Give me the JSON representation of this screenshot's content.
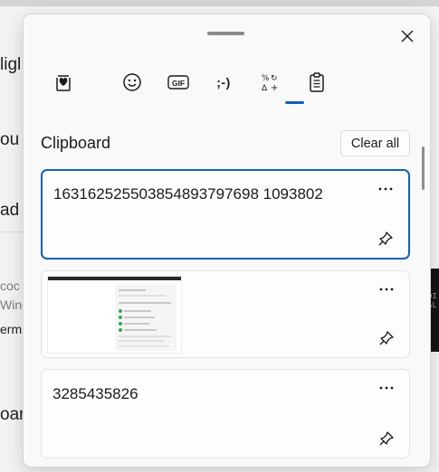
{
  "background": {
    "texts": [
      "ligl",
      "ou",
      "ad",
      "oard"
    ],
    "small_texts": [
      "coc",
      "Wind",
      "erm"
    ],
    "dark_snippet": [
      "DI",
      "AL"
    ]
  },
  "panel": {
    "tabs": [
      {
        "name": "tab-kaomoji-favorites",
        "icon": "heart-icon",
        "label": ""
      },
      {
        "name": "tab-emoji",
        "icon": "smiley-icon",
        "label": ""
      },
      {
        "name": "tab-gif",
        "icon": "gif-icon",
        "label": "GIF"
      },
      {
        "name": "tab-kaomoji",
        "icon": "winking-face-icon",
        "label": ";-)"
      },
      {
        "name": "tab-symbols",
        "icon": "symbols-icon",
        "label": "%↻\nΔ+"
      },
      {
        "name": "tab-clipboard",
        "icon": "clipboard-icon",
        "label": "",
        "selected": true
      }
    ],
    "section_title": "Clipboard",
    "clear_all_label": "Clear all",
    "items": [
      {
        "type": "text",
        "text": "163162525503854893797698 1093802",
        "selected": true
      },
      {
        "type": "image",
        "text": ""
      },
      {
        "type": "text",
        "text": "3285435826"
      }
    ],
    "colors": {
      "accent": "#0f62b4",
      "surface": "#f9f9f9",
      "card": "#fdfdfd"
    }
  }
}
